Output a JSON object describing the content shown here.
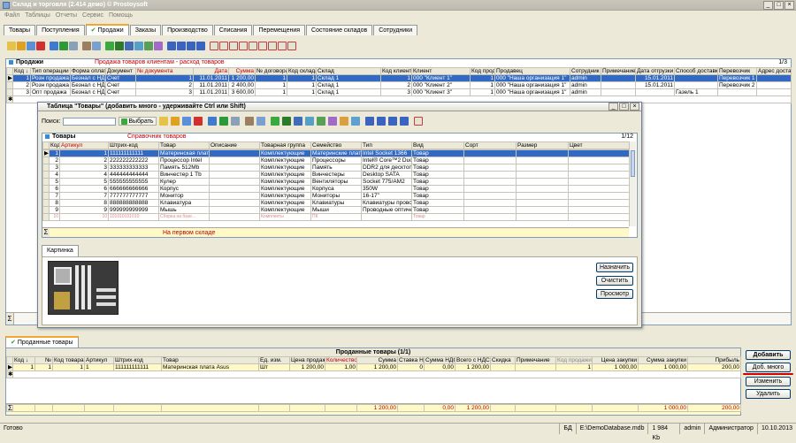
{
  "window": {
    "title": "Склад и торговля (2.414 демо) © Prostoysoft"
  },
  "menu": [
    "Файл",
    "Таблицы",
    "Отчеты",
    "Сервис",
    "Помощь"
  ],
  "tabs": [
    "Товары",
    "Поступления",
    "Продажи",
    "Заказы",
    "Производство",
    "Списания",
    "Перемещения",
    "Состояние складов",
    "Сотрудники"
  ],
  "active_tab": "Продажи",
  "sales": {
    "title": "Продажи",
    "subtitle": "Продажа товаров клиентам - расход товаров",
    "page": "1/3",
    "columns": [
      "Код ↓",
      "Тип операции",
      "Форма оплаты",
      "Документ",
      "№ документа",
      "Дата",
      "Сумма",
      "№ договора",
      "Код склада",
      "Склад",
      "Код клиента",
      "Клиент",
      "Код продавца",
      "Продавец",
      "Сотрудник",
      "Примечание",
      "Дата отгрузки",
      "Способ доставки",
      "Перевозчик",
      "Адрес доставки"
    ],
    "rows": [
      [
        "1",
        "Розн продажа",
        "Безнал с НДС",
        "Счет",
        "1",
        "11.01.2011",
        "1 200,00",
        "1",
        "1",
        "Склад 1",
        "1",
        "000 \"Клиент 1\"",
        "1",
        "000 \"Наша организация 1\"",
        "admin",
        "",
        "15.01.2011",
        "",
        "Перевозчик 1",
        ""
      ],
      [
        "2",
        "Розн продажа",
        "Безнал с НДС",
        "Счет",
        "2",
        "11.01.2011",
        "2 400,00",
        "1",
        "1",
        "Склад 1",
        "2",
        "000 \"Клиент 2\"",
        "1",
        "000 \"Наша организация 1\"",
        "admin",
        "",
        "15.01.2011",
        "",
        "Перевозчик 2",
        ""
      ],
      [
        "3",
        "Опт продажа",
        "Безнал с НДС",
        "Счет",
        "3",
        "11.01.2011",
        "3 600,00",
        "1",
        "1",
        "Склад 1",
        "3",
        "000 \"Клиент 3\"",
        "1",
        "000 \"Наша организация 1\"",
        "admin",
        "",
        "",
        "Газель 1",
        "",
        ""
      ]
    ]
  },
  "dialog": {
    "title": "Таблица \"Товары\" (добавить много - удерживайте Ctrl или Shift)",
    "search_label": "Поиск:",
    "choose_label": "Выбрать",
    "grid_title": "Товары",
    "grid_subtitle": "Справочник товаров",
    "page": "1/12",
    "columns": [
      "Код ↓",
      "Артикул",
      "Штрих-код",
      "Товар",
      "Описание",
      "Товарная группа",
      "Семейство",
      "Тип",
      "Вид",
      "Сорт",
      "Размер",
      "Цвет"
    ],
    "rows": [
      [
        "1",
        "1",
        "111111111111",
        "Материнская плата",
        "",
        "Комплектующие",
        "Материнские платы",
        "Intel Socket 1366",
        "Товар",
        "",
        "",
        ""
      ],
      [
        "2",
        "2",
        "222222222222",
        "Процессор Intel",
        "",
        "Комплектующие",
        "Процессоры",
        "Intel® Core™2 Duo E",
        "Товар",
        "",
        "",
        ""
      ],
      [
        "3",
        "3",
        "333333333333",
        "Память 512Mb",
        "",
        "Комплектующие",
        "Память",
        "DDR2 для десктоп",
        "Товар",
        "",
        "",
        ""
      ],
      [
        "4",
        "4",
        "444444444444",
        "Винчестер 1 Tb",
        "",
        "Комплектующие",
        "Винчестеры",
        "Desktop SATA",
        "Товар",
        "",
        "",
        ""
      ],
      [
        "5",
        "5",
        "555555555555",
        "Кулер",
        "",
        "Комплектующие",
        "Вентиляторы",
        "Socket 775/AM2",
        "Товар",
        "",
        "",
        ""
      ],
      [
        "6",
        "6",
        "666666666666",
        "Корпус",
        "",
        "Комплектующие",
        "Корпуса",
        "350W",
        "Товар",
        "",
        "",
        ""
      ],
      [
        "7",
        "7",
        "777777777777",
        "Монитор",
        "",
        "Комплектующие",
        "Мониторы",
        "16-17\"",
        "Товар",
        "",
        "",
        ""
      ],
      [
        "8",
        "8",
        "888888888888",
        "Клавиатура",
        "",
        "Комплектующие",
        "Клавиатуры",
        "Клавиатуры провод",
        "Товар",
        "",
        "",
        ""
      ],
      [
        "9",
        "9",
        "999999999999",
        "Мышь",
        "",
        "Комплектующие",
        "Мыши",
        "Проводные оптиче",
        "Товар",
        "",
        "",
        ""
      ],
      [
        "10",
        "10",
        "101010101010",
        "Сборка на базе...",
        "",
        "Комплекты",
        "ПК",
        "",
        "Товар",
        "",
        "",
        ""
      ]
    ],
    "footer_text": "На первом складе",
    "picture_tab": "Картинка",
    "buttons": [
      "Назначить",
      "Очистить",
      "Просмотр"
    ]
  },
  "bottom": {
    "tab": "Проданные товары",
    "title": "Проданные товары (1/1)",
    "columns": [
      "Код ↓",
      "№",
      "Код товара",
      "Артикул",
      "Штрих-код",
      "Товар",
      "Ед. изм.",
      "Цена продажи",
      "Количество",
      "Сумма",
      "Ставка НДС",
      "Сумма НДС",
      "Всего с НДС",
      "Скидка",
      "Примечание",
      "Код продажи",
      "Цена закупки",
      "Сумма закупки",
      "Прибыль"
    ],
    "rows": [
      [
        "1",
        "1",
        "1",
        "1",
        "111111111111",
        "Материнская плата Asus",
        "Шт",
        "1 200,00",
        "1,00",
        "1 200,00",
        "0",
        "0,00",
        "1 200,00",
        "",
        "",
        "1",
        "1 000,00",
        "1 000,00",
        "200,00"
      ]
    ],
    "totals": [
      "",
      "",
      "",
      "",
      "",
      "",
      "",
      "",
      "",
      "1 200,00",
      "",
      "0,00",
      "1 200,00",
      "",
      "",
      "",
      "",
      "1 000,00",
      "200,00"
    ],
    "buttons": [
      "Добавить",
      "Доб. много",
      "Изменить",
      "Удалить"
    ]
  },
  "status": [
    "Готово",
    "БД",
    "E:\\DemoDatabase.mdb",
    "1 984 Kb",
    "admin",
    "Администратор",
    "10.10.2013"
  ]
}
